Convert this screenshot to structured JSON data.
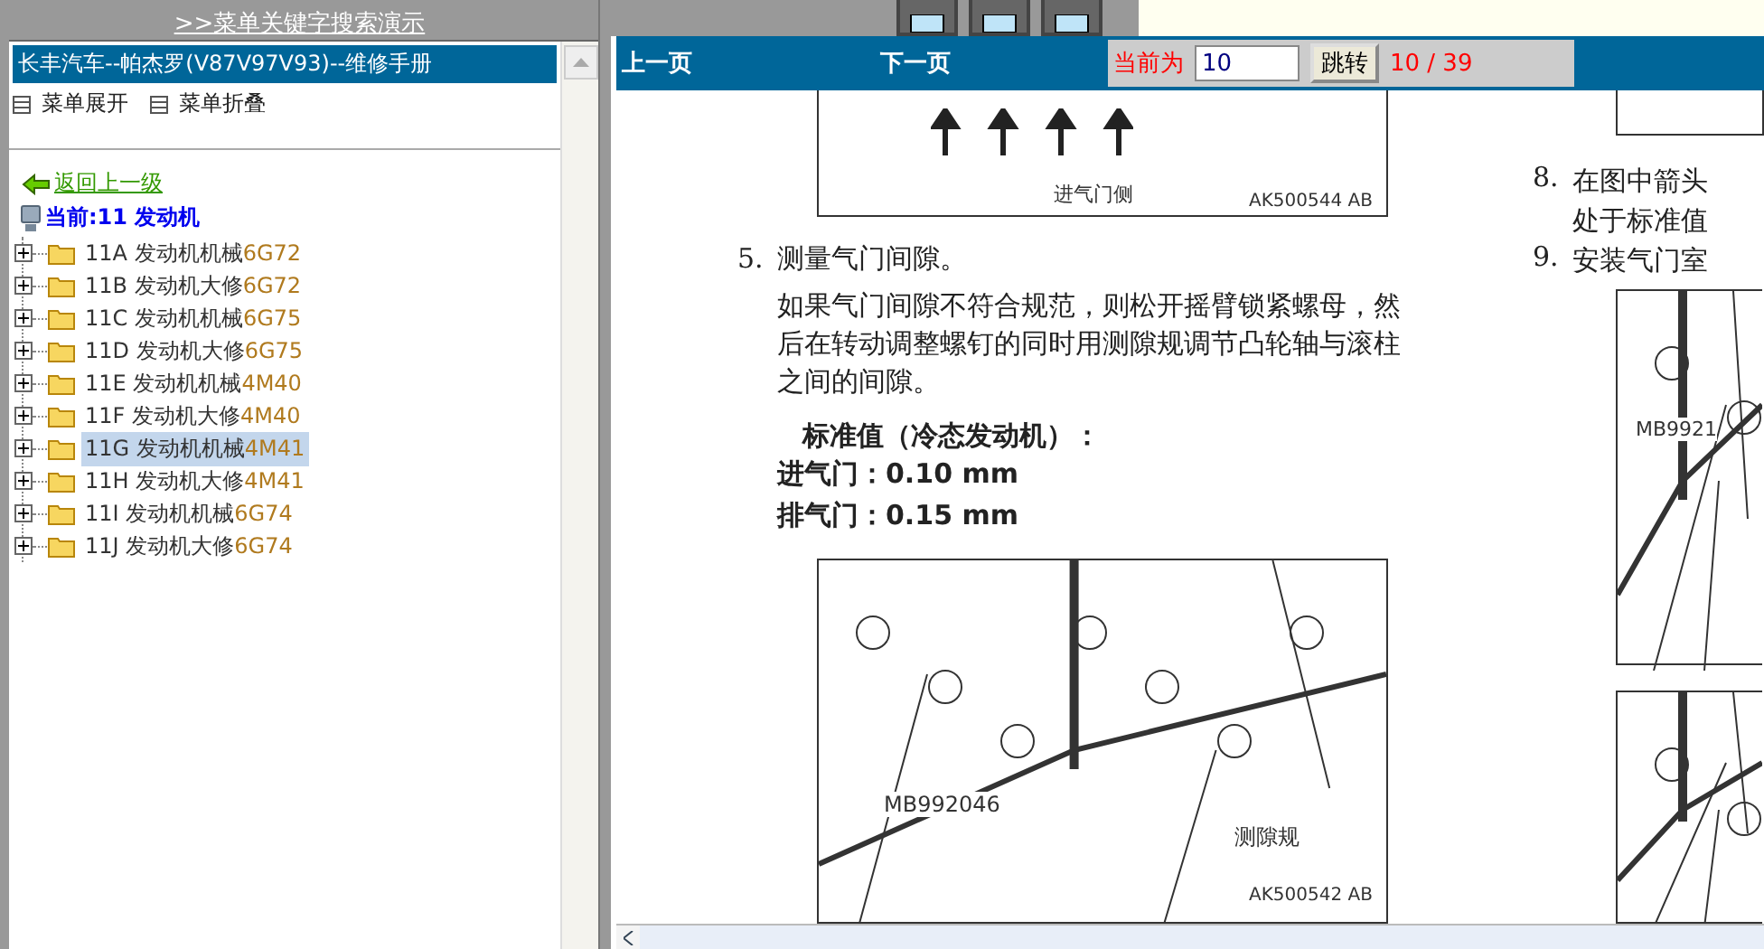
{
  "top_bar": {
    "link": ">>菜单关键字搜索演示"
  },
  "sidebar": {
    "title": "长丰汽车--帕杰罗(V87V97V93)--维修手册",
    "menu_buttons": [
      {
        "label": "菜单展开"
      },
      {
        "label": "菜单折叠"
      }
    ],
    "back_link": "返回上一级",
    "current": "当前:11 发动机",
    "items": [
      {
        "code": "11A",
        "name": "发动机机械",
        "model": "6G72",
        "expanded": false,
        "selected": false
      },
      {
        "code": "11B",
        "name": "发动机大修",
        "model": "6G72",
        "expanded": false,
        "selected": false
      },
      {
        "code": "11C",
        "name": "发动机机械",
        "model": "6G75",
        "expanded": false,
        "selected": false
      },
      {
        "code": "11D",
        "name": "发动机大修",
        "model": "6G75",
        "expanded": false,
        "selected": false
      },
      {
        "code": "11E",
        "name": "发动机机械",
        "model": "4M40",
        "expanded": false,
        "selected": false
      },
      {
        "code": "11F",
        "name": "发动机大修",
        "model": "4M40",
        "expanded": false,
        "selected": false
      },
      {
        "code": "11G",
        "name": "发动机机械",
        "model": "4M41",
        "expanded": false,
        "selected": true
      },
      {
        "code": "11H",
        "name": "发动机大修",
        "model": "4M41",
        "expanded": false,
        "selected": false
      },
      {
        "code": "11I",
        "name": "发动机机械",
        "model": "6G74",
        "expanded": false,
        "selected": false
      },
      {
        "code": "11J",
        "name": "发动机大修",
        "model": "6G74",
        "expanded": false,
        "selected": false
      }
    ]
  },
  "pager": {
    "prev": "上一页",
    "next": "下一页",
    "current_label": "当前为",
    "page_input": "10",
    "go_button": "跳转",
    "page_count": "10 / 39"
  },
  "document": {
    "left_column": {
      "figure_top": {
        "caption": "进气门侧",
        "code": "AK500544 AB"
      },
      "step": {
        "number": "5.",
        "title": "测量气门间隙。",
        "body": "如果气门间隙不符合规范，则松开摇臂锁紧螺母，然后在转动调整螺钉的同时用测隙规调节凸轮轴与滚柱之间的间隙。"
      },
      "spec_heading": "标准值（冷态发动机）：",
      "spec_lines": [
        "进气门：0.10 mm",
        "排气门：0.15 mm"
      ],
      "figure_bottom": {
        "tool_label": "MB992046",
        "gauge_label": "测隙规",
        "code": "AK500542 AB"
      }
    },
    "right_column": {
      "steps": [
        {
          "number": "8.",
          "lines": [
            "在图中箭头",
            "处于标准值"
          ]
        },
        {
          "number": "9.",
          "lines": [
            "安装气门室"
          ]
        }
      ],
      "figure_label": "MB9921"
    }
  }
}
